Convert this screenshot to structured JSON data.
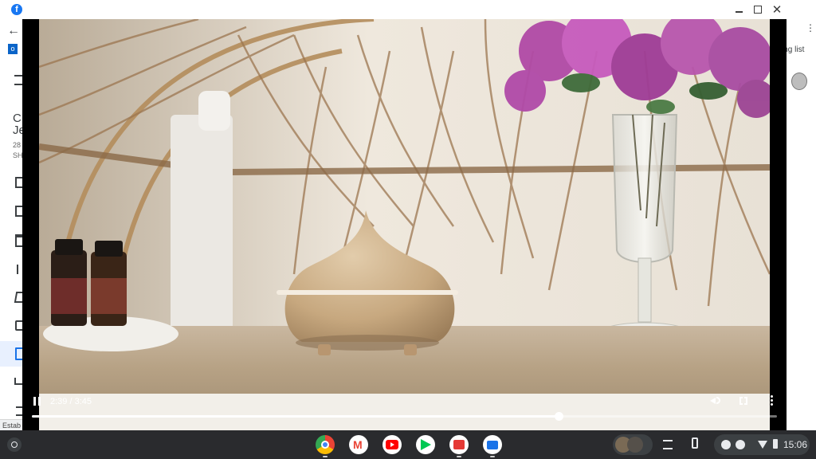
{
  "window": {
    "minimize_icon": "minimize-icon",
    "maximize_icon": "maximize-icon",
    "close_icon": "close-icon"
  },
  "page_behind": {
    "partial_right_text": "ing list",
    "status_text": "Estab",
    "left_partial_chars": [
      "C",
      "Je",
      "28",
      "SH"
    ]
  },
  "video": {
    "time": "2:39 / 3:45",
    "progress": 0.707,
    "playing": true
  },
  "taskbar": {
    "apps": [
      "Chrome",
      "Gmail",
      "YouTube",
      "Play Store",
      "Screencast",
      "Files"
    ],
    "clock": "15:06"
  },
  "colors": {
    "taskbar": "#2a2b2e",
    "accent": "#1a73e8"
  }
}
